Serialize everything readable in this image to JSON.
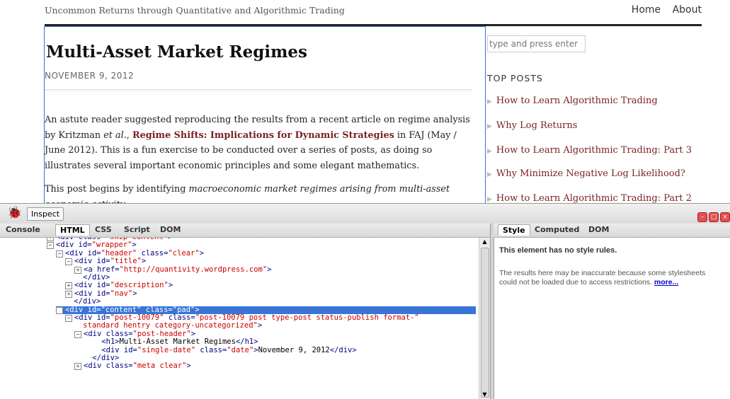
{
  "site": {
    "description": "Uncommon Returns through Quantitative and Algorithmic Trading",
    "nav": [
      "Home",
      "About"
    ]
  },
  "post": {
    "title": "Multi-Asset Market Regimes",
    "date": "NOVEMBER 9, 2012",
    "para1_a": "An astute reader suggested reproducing the results from a recent article on regime analysis by Kritzman ",
    "para1_em": "et al.",
    "para1_b": ", ",
    "para1_link": "Regime Shifts: Implications for Dynamic Strategies",
    "para1_c": " in FAJ (May / June 2012). This is a fun exercise to be conducted over a series of posts, as doing so illustrates several important economic principles and some elegant mathematics.",
    "para2_a": "This post begins by identifying ",
    "para2_em": "macroeconomic market regimes arising from multi-asset economic activity"
  },
  "sidebar": {
    "search_placeholder": "type and press enter",
    "top_posts_heading": "TOP POSTS",
    "top_posts": [
      "How to Learn Algorithmic Trading",
      "Why Log Returns",
      "How to Learn Algorithmic Trading: Part 3",
      "Why Minimize Negative Log Likelihood?",
      "How to Learn Algorithmic Trading: Part 2"
    ]
  },
  "firebug": {
    "inspect_label": "Inspect",
    "main_tabs": [
      "Console",
      "HTML",
      "CSS",
      "Script",
      "DOM"
    ],
    "active_main_tab": "HTML",
    "side_tabs": [
      "Style",
      "Computed",
      "DOM"
    ],
    "active_side_tab": "Style",
    "no_rules": "This element has no style rules.",
    "inaccurate_text": "The results here may be inaccurate because some stylesheets could not be loaded due to access restrictions. ",
    "more_link": "more...",
    "tree": [
      {
        "indent": 0,
        "toggle": "+",
        "tag": "div",
        "attrs": [
          [
            "class",
            "skip-content"
          ]
        ],
        "tail": "",
        "close": false,
        "partial": true
      },
      {
        "indent": 0,
        "toggle": "-",
        "tag": "div",
        "attrs": [
          [
            "id",
            "wrapper"
          ]
        ],
        "tail": "",
        "close": false
      },
      {
        "indent": 1,
        "toggle": "-",
        "tag": "div",
        "attrs": [
          [
            "id",
            "header"
          ],
          [
            "class",
            "clear"
          ]
        ],
        "tail": "",
        "close": false
      },
      {
        "indent": 2,
        "toggle": "-",
        "tag": "div",
        "attrs": [
          [
            "id",
            "title"
          ]
        ],
        "tail": "",
        "close": false
      },
      {
        "indent": 3,
        "toggle": "+",
        "tag": "a",
        "attrs": [
          [
            "href",
            "http://quantivity.wordpress.com"
          ]
        ],
        "tail": "",
        "close": false
      },
      {
        "indent": 2,
        "toggle": "",
        "endtag": "div"
      },
      {
        "indent": 2,
        "toggle": "+",
        "tag": "div",
        "attrs": [
          [
            "id",
            "description"
          ]
        ],
        "tail": "",
        "close": false
      },
      {
        "indent": 2,
        "toggle": "+",
        "tag": "div",
        "attrs": [
          [
            "id",
            "nav"
          ]
        ],
        "tail": "",
        "close": false
      },
      {
        "indent": 1,
        "toggle": "",
        "endtag": "div"
      },
      {
        "indent": 1,
        "toggle": "-",
        "tag": "div",
        "attrs": [
          [
            "id",
            "content"
          ],
          [
            "class",
            "pad"
          ]
        ],
        "tail": "",
        "close": false,
        "selected": true
      },
      {
        "indent": 2,
        "toggle": "-",
        "tag": "div",
        "attrs": [
          [
            "id",
            "post-10079"
          ],
          [
            "class",
            "post-10079 post type-post status-publish format-"
          ]
        ],
        "tail": "",
        "close": false,
        "nogt": true
      },
      {
        "indent": 2,
        "toggle": "",
        "cont": "standard hentry category-uncategorized\">"
      },
      {
        "indent": 3,
        "toggle": "-",
        "tag": "div",
        "attrs": [
          [
            "class",
            "post-header"
          ]
        ],
        "tail": "",
        "close": false
      },
      {
        "indent": 4,
        "toggle": "",
        "tag": "h1",
        "attrs": [],
        "tail": "Multi-Asset Market Regimes",
        "close": true
      },
      {
        "indent": 4,
        "toggle": "",
        "tag": "div",
        "attrs": [
          [
            "id",
            "single-date"
          ],
          [
            "class",
            "date"
          ]
        ],
        "tail": "November 9, 2012",
        "close": true
      },
      {
        "indent": 3,
        "toggle": "",
        "endtag": "div"
      },
      {
        "indent": 3,
        "toggle": "+",
        "tag": "div",
        "attrs": [
          [
            "class",
            "meta clear"
          ]
        ],
        "tail": "",
        "close": false
      }
    ]
  }
}
